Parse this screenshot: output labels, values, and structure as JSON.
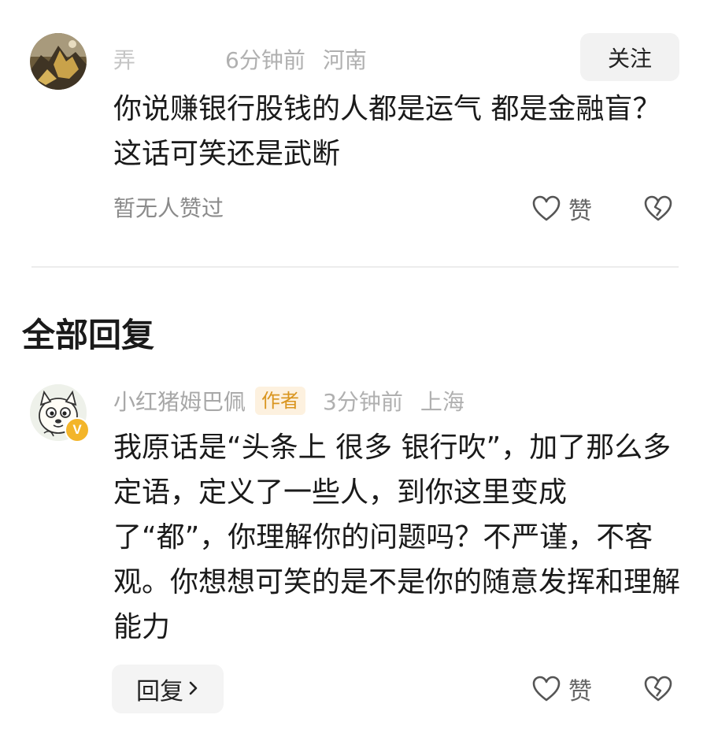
{
  "comment": {
    "username": "弄",
    "time": "6分钟前",
    "location": "河南",
    "follow_label": "关注",
    "text": "你说赚银行股钱的人都是运气 都是金融盲？ 这话可笑还是武断",
    "no_likes": "暂无人赞过",
    "like_label": "赞"
  },
  "section_title": "全部回复",
  "reply": {
    "username": "小红猪姆巴佩",
    "author_badge": "作者",
    "time": "3分钟前",
    "location": "上海",
    "verified_badge": "V",
    "text": "我原话是“头条上 很多 银行吹”，加了那么多定语，定义了一些人，到你这里变成了“都”，你理解你的问题吗？不严谨，不客观。你想想可笑的是不是你的随意发挥和理解能力",
    "reply_button_label": "回复",
    "like_label": "赞"
  },
  "icons": {
    "like": "heart-outline-icon",
    "dislike": "broken-heart-icon",
    "chevron": "chevron-right-icon"
  },
  "colors": {
    "meta_text": "#b0b0b0",
    "author_badge_bg": "#fdf1df",
    "author_badge_text": "#d9951f",
    "verified_badge": "#f3b52a"
  }
}
